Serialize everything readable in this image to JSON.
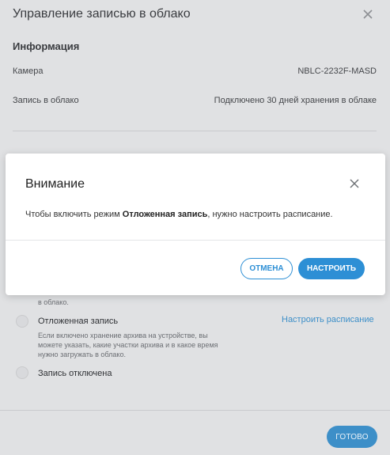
{
  "panel": {
    "title": "Управление записью в облако",
    "info_section_title": "Информация",
    "info_rows": [
      {
        "label": "Камера",
        "value": "NBLC-2232F-MASD"
      },
      {
        "label": "Запись в облако",
        "value": "Подключено 30 дней хранения в облаке"
      }
    ],
    "partial_desc_tail": "в облако.",
    "options": [
      {
        "label": "Отложенная запись",
        "desc": "Если включено хранение архива на устройстве, вы можете указать, какие участки архива и в какое время нужно загружать в облако.",
        "link": "Настроить расписание"
      },
      {
        "label": "Запись отключена"
      }
    ],
    "done_label": "ГОТОВО"
  },
  "dialog": {
    "title": "Внимание",
    "text_before": "Чтобы включить режим ",
    "text_bold": "Отложенная запись",
    "text_after": ", нужно настроить расписание.",
    "cancel_label": "ОТМЕНА",
    "configure_label": "НАСТРОИТЬ"
  },
  "colors": {
    "accent": "#2d8fd5",
    "overlay": "#e0e1e3"
  },
  "icons": {
    "panel_close": "close-icon",
    "dialog_close": "close-icon"
  }
}
